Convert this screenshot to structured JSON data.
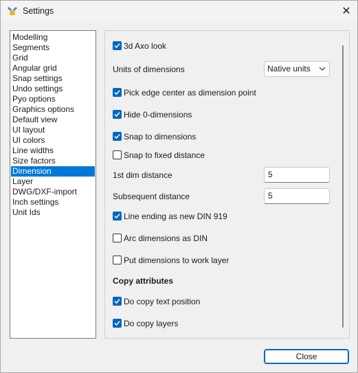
{
  "window": {
    "title": "Settings"
  },
  "icons": {
    "app": "settings-app-icon",
    "close": "close-icon",
    "checkmark": "checkmark-icon",
    "dropdown": "chevron-down-icon"
  },
  "colors": {
    "accent": "#0078d7",
    "checkbox_on": "#0067c0"
  },
  "sidebar": {
    "selected_index": 14,
    "items": [
      {
        "label": "Modelling"
      },
      {
        "label": "Segments"
      },
      {
        "label": "Grid"
      },
      {
        "label": "Angular grid"
      },
      {
        "label": "Snap settings"
      },
      {
        "label": "Undo settings"
      },
      {
        "label": "Pyo options"
      },
      {
        "label": "Graphics options"
      },
      {
        "label": "Default view"
      },
      {
        "label": "UI layout"
      },
      {
        "label": "UI colors"
      },
      {
        "label": "Line widths"
      },
      {
        "label": "Size factors"
      },
      {
        "label": "Dimension"
      },
      {
        "label": "Layer"
      },
      {
        "label": "DWG/DXF-import"
      },
      {
        "label": "Inch settings"
      },
      {
        "label": "Unit Ids"
      }
    ]
  },
  "dimension": {
    "axo_look": {
      "label": "3d Axo look",
      "checked": true
    },
    "units": {
      "label": "Units of dimensions",
      "value": "Native units"
    },
    "pick_edge_center": {
      "label": "Pick edge center as dimension point",
      "checked": true
    },
    "hide_zero": {
      "label": "Hide 0-dimensions",
      "checked": true
    },
    "snap_to_dims": {
      "label": "Snap to dimensions",
      "checked": true
    },
    "snap_fixed": {
      "label": "Snap to fixed distance",
      "checked": false
    },
    "first_dist": {
      "label": "1st dim distance",
      "value": "5"
    },
    "subsequent_dist": {
      "label": "Subsequent distance",
      "value": "5"
    },
    "line_ending": {
      "label": "Line ending as new DIN 919",
      "checked": true
    },
    "arc_din": {
      "label": "Arc dimensions as DIN",
      "checked": false
    },
    "work_layer": {
      "label": "Put dimensions to work layer",
      "checked": false
    },
    "copy_heading": "Copy attributes",
    "copy_text_pos": {
      "label": "Do copy text position",
      "checked": true
    },
    "copy_layers": {
      "label": "Do copy layers",
      "checked": true
    }
  },
  "footer": {
    "close_label": "Close"
  }
}
